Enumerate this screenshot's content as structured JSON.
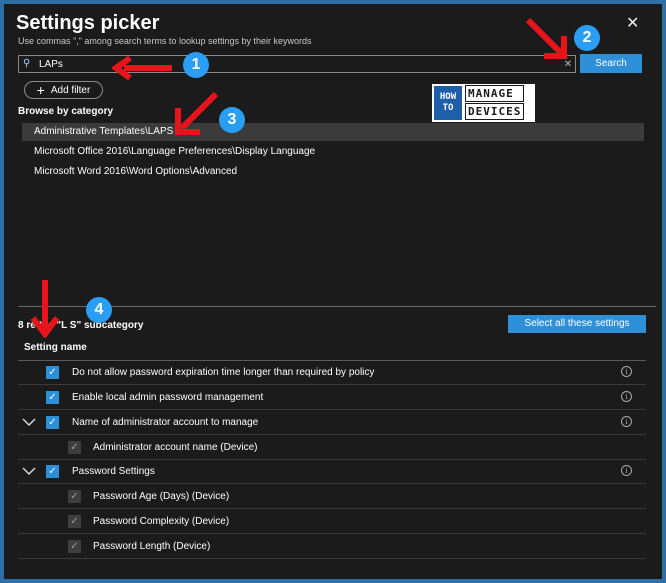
{
  "panel": {
    "title": "Settings picker",
    "subtitle": "Use commas \",\" among search terms to lookup settings by their keywords"
  },
  "search": {
    "value": "LAPs",
    "button_label": "Search"
  },
  "filter": {
    "add_label": "Add filter"
  },
  "browse": {
    "label": "Browse by category",
    "categories": [
      "Administrative Templates\\LAPS",
      "Microsoft Office 2016\\Language Preferences\\Display Language",
      "Microsoft Word 2016\\Word Options\\Advanced"
    ]
  },
  "logo": {
    "left_text": "HOW TO",
    "right_lines": [
      "MANAGE",
      "DEVICES"
    ]
  },
  "results": {
    "summary": "8 re        the \"L  S\" subcategory",
    "select_all_label": "Select all these settings",
    "column_header": "Setting name",
    "rows": [
      {
        "label": "Do not allow password expiration time longer than required by policy"
      },
      {
        "label": "Enable local admin password management"
      },
      {
        "label": "Name of administrator account to manage"
      },
      {
        "label": "Administrator account name (Device)"
      },
      {
        "label": "Password Settings"
      },
      {
        "label": "Password Age (Days) (Device)"
      },
      {
        "label": "Password Complexity (Device)"
      },
      {
        "label": "Password Length (Device)"
      }
    ]
  },
  "callouts": [
    "1",
    "2",
    "3",
    "4"
  ],
  "colors": {
    "accent": "#2d8fd8",
    "badge": "#2a9df4",
    "arrow": "#e8141b",
    "frame": "#2f6fa9"
  }
}
